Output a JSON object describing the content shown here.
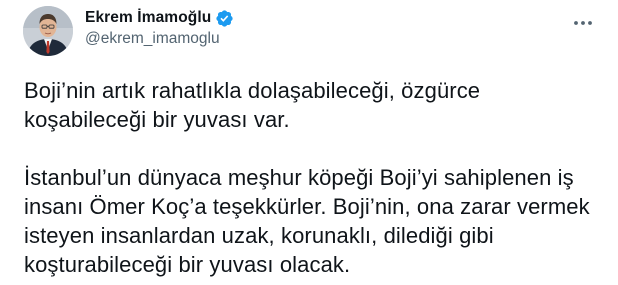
{
  "author": {
    "display_name": "Ekrem İmamoğlu",
    "handle": "@ekrem_imamoglu",
    "verified": true,
    "avatar_icon": "profile-photo",
    "verified_icon": "verified-badge-icon"
  },
  "menu": {
    "icon": "more-options-icon"
  },
  "tweet": {
    "paragraphs": [
      "Boji’nin artık rahatlıkla dolaşabileceği, özgürce koşabileceği bir yuvası var.",
      "İstanbul’un dünyaca meşhur köpeği Boji’yi sahiplenen iş insanı Ömer Koç’a teşekkürler. Boji’nin, ona zarar vermek isteyen insanlardan uzak, korunaklı, dilediği gibi koşturabileceği bir yuvası olacak."
    ]
  },
  "colors": {
    "text": "#0f1419",
    "secondary": "#536471",
    "verified": "#1d9bf0",
    "background": "#ffffff"
  }
}
